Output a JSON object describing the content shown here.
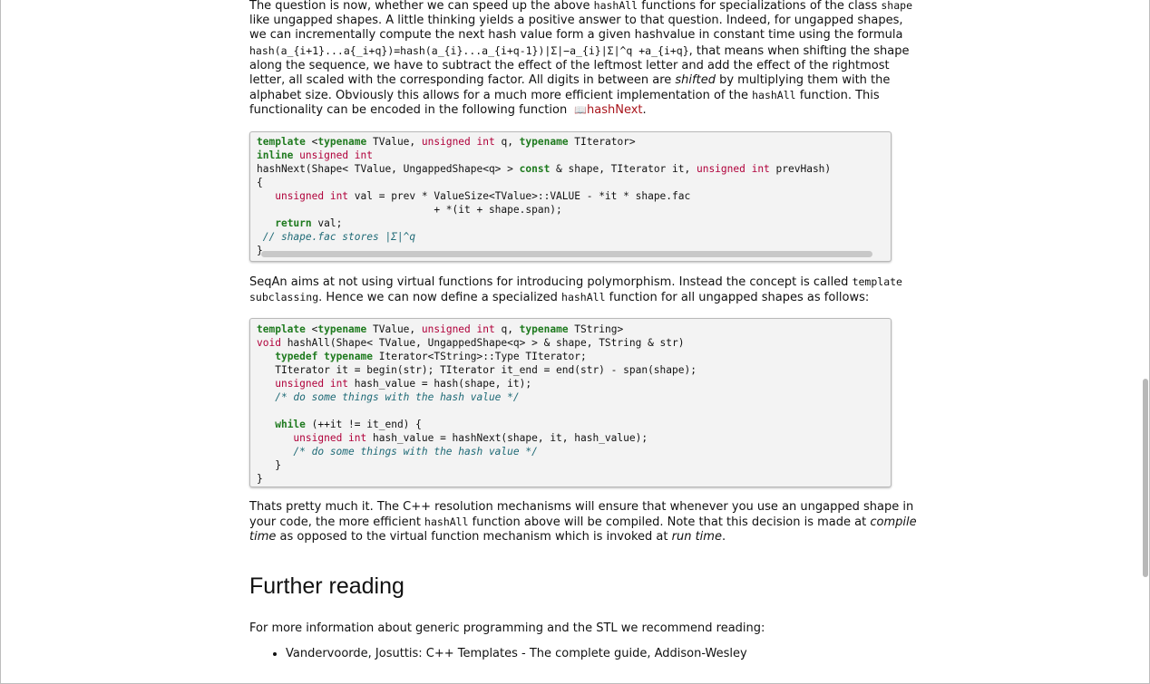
{
  "section1": {
    "t1": "The question is now, whether we can speed up the above ",
    "c1": "hashAll",
    "t2": " functions for specializations of the class ",
    "c2": "shape",
    "t3": " like ungapped shapes. A little thinking yields a positive answer to that question. Indeed, for ungapped shapes, we can incrementally compute the next hash value form a given hashvalue in constant time using the formula ",
    "c3": "hash(a_{i+1}...a{_i+q})=hash(a_{i}...a_{i+q-1})|Σ|−a_{i}|Σ|^q +a_{i+q}",
    "t4": ", that means when shifting the shape along the sequence, we have to subtract the effect of the leftmost letter and add the effect of the rightmost letter, all scaled with the corresponding factor. All digits in between are ",
    "em1": "shifted",
    "t5": " by multiplying them with the alphabet size. Obviously this allows for a much more efficient implementation of the ",
    "c4": "hashAll",
    "t6": " function. This functionality can be encoded in the following function ",
    "link": "hashNext",
    "t7": "."
  },
  "code1": {
    "l1": {
      "kw1": "template",
      "p1": " <",
      "kw2": "typename",
      "p2": " TValue, ",
      "ty1": "unsigned int",
      "p3": " q, ",
      "kw3": "typename",
      "p4": " TIterator>"
    },
    "l2": {
      "kw1": "inline",
      "p1": " ",
      "ty1": "unsigned int"
    },
    "l3": {
      "p1": "hashNext(Shape< TValue, UngappedShape<q> > ",
      "kw1": "const",
      "p2": " & shape, TIterator it, ",
      "ty1": "unsigned int",
      "p3": " prevHash)"
    },
    "l4": "{",
    "l5": {
      "p0": "   ",
      "ty1": "unsigned int",
      "p1": " val = prev * ValueSize<TValue>::VALUE - *it * shape.fac"
    },
    "l6": "                             + *(it + shape.span);",
    "l7": {
      "p0": "   ",
      "kw1": "return",
      "p1": " val;"
    },
    "l8": " // shape.fac stores |Σ|^q",
    "l9": "}"
  },
  "section2": {
    "t1": "SeqAn aims at not using virtual functions for introducing polymorphism. Instead the concept is called ",
    "c1": "template subclassing",
    "t2": ". Hence we can now define a specialized ",
    "c2": "hashAll",
    "t3": " function for all ungapped shapes as follows:"
  },
  "code2": {
    "l1": {
      "kw1": "template",
      "p1": " <",
      "kw2": "typename",
      "p2": " TValue, ",
      "ty1": "unsigned int",
      "p3": " q, ",
      "kw3": "typename",
      "p4": " TString>"
    },
    "l2": {
      "ty1": "void",
      "p1": " hashAll(Shape< TValue, UngappedShape<q> > & shape, TString & str)"
    },
    "l3": {
      "p0": "   ",
      "kw1": "typedef typename",
      "p1": " Iterator<TString>::Type TIterator;"
    },
    "l4": "   TIterator it = begin(str); TIterator it_end = end(str) - span(shape);",
    "l5": {
      "p0": "   ",
      "ty1": "unsigned int",
      "p1": " hash_value = hash(shape, it);"
    },
    "l6": "   /* do some things with the hash value */",
    "l7": "",
    "l8": {
      "p0": "   ",
      "kw1": "while",
      "p1": " (++it != it_end) {"
    },
    "l9": {
      "p0": "      ",
      "ty1": "unsigned int",
      "p1": " hash_value = hashNext(shape, it, hash_value);"
    },
    "l10": "      /* do some things with the hash value */",
    "l11": "   }",
    "l12": "}"
  },
  "section3": {
    "t1": "Thats pretty much it. The C++ resolution mechanisms will ensure that whenever you use an ungapped shape in your code, the more efficient ",
    "c1": "hashAll",
    "t2": " function above will be compiled. Note that this decision is made at ",
    "em1": "compile time",
    "t3": " as opposed to the virtual function mechanism which is invoked at ",
    "em2": "run time",
    "t4": "."
  },
  "further": {
    "heading": "Further reading",
    "intro": "For more information about generic programming and the STL we recommend reading:",
    "items": [
      "Vandervoorde, Josuttis: C++ Templates - The complete guide, Addison-Wesley"
    ]
  }
}
